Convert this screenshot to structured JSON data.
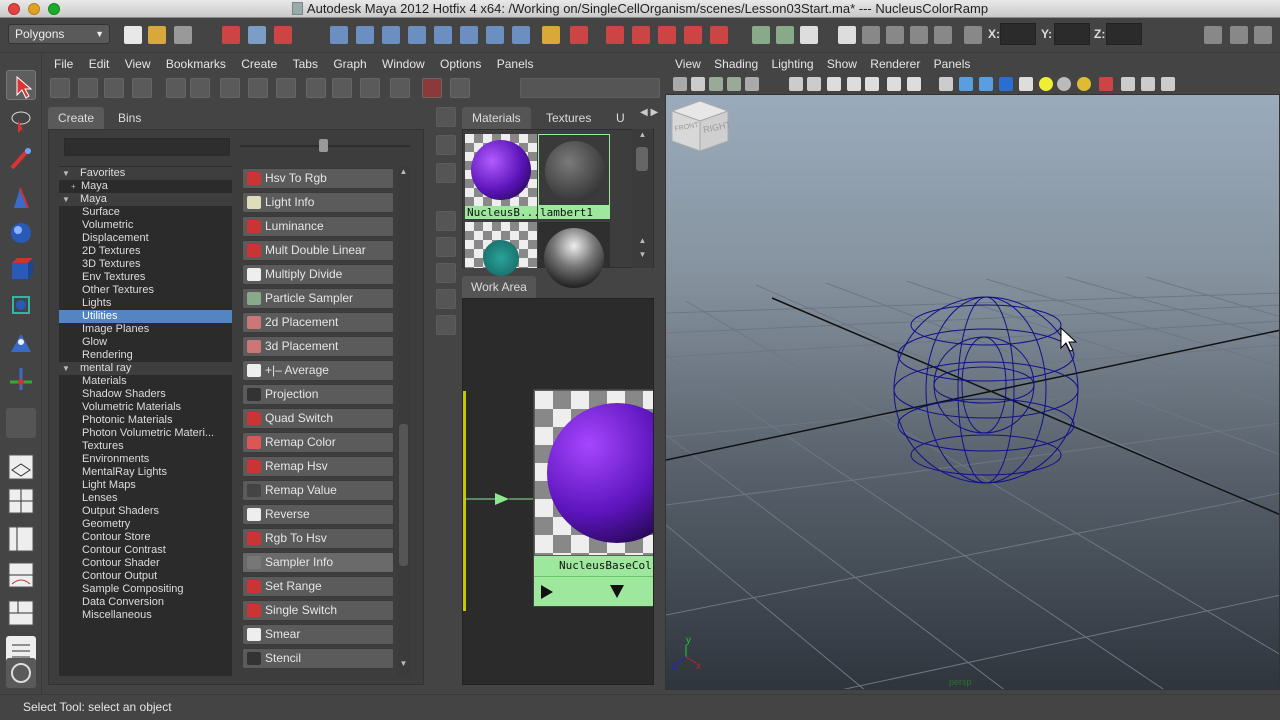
{
  "window": {
    "title": "Autodesk Maya 2012 Hotfix 4 x64: /Working on/SingleCellOrganism/scenes/Lesson03Start.ma*   ---   NucleusColorRamp"
  },
  "statusline": {
    "mode": "Polygons",
    "coord_x": "X:",
    "coord_y": "Y:",
    "coord_z": "Z:"
  },
  "hypershade": {
    "menus": [
      "File",
      "Edit",
      "View",
      "Bookmarks",
      "Create",
      "Tabs",
      "Graph",
      "Window",
      "Options",
      "Panels"
    ],
    "create_tabs": [
      "Create",
      "Bins"
    ],
    "tree": [
      {
        "label": "Favorites",
        "level": 0,
        "header": true,
        "expander": "▼"
      },
      {
        "label": "Maya",
        "level": 1,
        "expander": "+"
      },
      {
        "label": "Maya",
        "level": 0,
        "header": true,
        "expander": "▼"
      },
      {
        "label": "Surface",
        "level": 2
      },
      {
        "label": "Volumetric",
        "level": 2
      },
      {
        "label": "Displacement",
        "level": 2
      },
      {
        "label": "2D Textures",
        "level": 2
      },
      {
        "label": "3D Textures",
        "level": 2
      },
      {
        "label": "Env Textures",
        "level": 2
      },
      {
        "label": "Other Textures",
        "level": 2
      },
      {
        "label": "Lights",
        "level": 2
      },
      {
        "label": "Utilities",
        "level": 2,
        "selected": true
      },
      {
        "label": "Image Planes",
        "level": 2
      },
      {
        "label": "Glow",
        "level": 2
      },
      {
        "label": "Rendering",
        "level": 2
      },
      {
        "label": "mental ray",
        "level": 0,
        "header": true,
        "expander": "▼"
      },
      {
        "label": "Materials",
        "level": 2
      },
      {
        "label": "Shadow Shaders",
        "level": 2
      },
      {
        "label": "Volumetric Materials",
        "level": 2
      },
      {
        "label": "Photonic Materials",
        "level": 2
      },
      {
        "label": "Photon Volumetric Materi...",
        "level": 2
      },
      {
        "label": "Textures",
        "level": 2
      },
      {
        "label": "Environments",
        "level": 2
      },
      {
        "label": "MentalRay Lights",
        "level": 2
      },
      {
        "label": "Light Maps",
        "level": 2
      },
      {
        "label": "Lenses",
        "level": 2
      },
      {
        "label": "Output Shaders",
        "level": 2
      },
      {
        "label": "Geometry",
        "level": 2
      },
      {
        "label": "Contour Store",
        "level": 2
      },
      {
        "label": "Contour Contrast",
        "level": 2
      },
      {
        "label": "Contour Shader",
        "level": 2
      },
      {
        "label": "Contour Output",
        "level": 2
      },
      {
        "label": "Sample Compositing",
        "level": 2
      },
      {
        "label": "Data Conversion",
        "level": 2
      },
      {
        "label": "Miscellaneous",
        "level": 2
      }
    ],
    "nodes": [
      {
        "label": "Hsv To Rgb",
        "icon_color": "#c33"
      },
      {
        "label": "Light Info",
        "icon_color": "#ddb"
      },
      {
        "label": "Luminance",
        "icon_color": "#c33"
      },
      {
        "label": "Mult Double Linear",
        "icon_color": "#c33"
      },
      {
        "label": "Multiply Divide",
        "icon_color": "#eee"
      },
      {
        "label": "Particle Sampler",
        "icon_color": "#8a8"
      },
      {
        "label": "2d Placement",
        "icon_color": "#c77"
      },
      {
        "label": "3d Placement",
        "icon_color": "#c77"
      },
      {
        "label": "+|– Average",
        "icon_color": "#eee"
      },
      {
        "label": "Projection",
        "icon_color": "#333"
      },
      {
        "label": "Quad Switch",
        "icon_color": "#c33"
      },
      {
        "label": "Remap Color",
        "icon_color": "#d55"
      },
      {
        "label": "Remap Hsv",
        "icon_color": "#c33"
      },
      {
        "label": "Remap Value",
        "icon_color": "#444"
      },
      {
        "label": "Reverse",
        "icon_color": "#eee"
      },
      {
        "label": "Rgb To Hsv",
        "icon_color": "#c33"
      },
      {
        "label": "Sampler Info",
        "icon_color": "#777",
        "highlight": true
      },
      {
        "label": "Set Range",
        "icon_color": "#c33"
      },
      {
        "label": "Single Switch",
        "icon_color": "#c33"
      },
      {
        "label": "Smear",
        "icon_color": "#eee"
      },
      {
        "label": "Stencil",
        "icon_color": "#333"
      }
    ],
    "material_tabs": [
      "Materials",
      "Textures",
      "U"
    ],
    "materials": [
      {
        "label": "NucleusB...",
        "sphere": "purple"
      },
      {
        "label": "lambert1",
        "sphere": "gray"
      }
    ],
    "work_area_tab": "Work Area",
    "work_area_node_label": "NucleusBaseCol"
  },
  "viewport": {
    "menus": [
      "View",
      "Shading",
      "Lighting",
      "Show",
      "Renderer",
      "Panels"
    ],
    "viewcube_front": "FRONT",
    "viewcube_right": "RIGHT",
    "camera_label": "persp",
    "axis_y": "y",
    "axis_x": "x",
    "axis_z": "z"
  },
  "helpline": {
    "text": "Select Tool: select an object"
  }
}
